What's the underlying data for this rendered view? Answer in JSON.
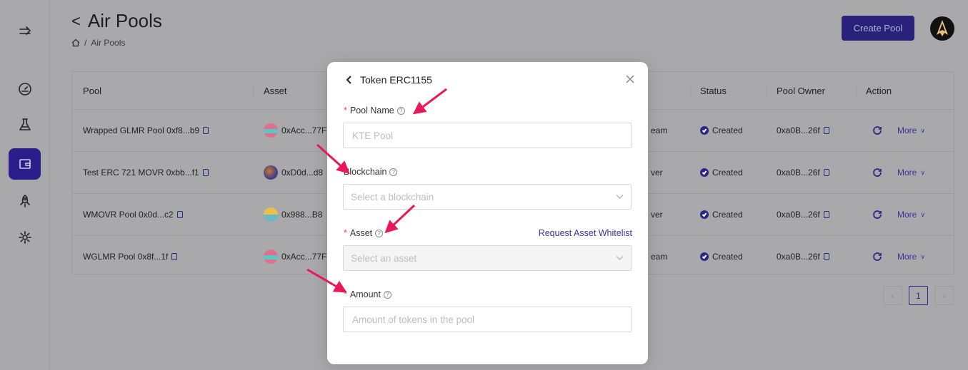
{
  "header": {
    "title": "Air Pools",
    "back_glyph": "<",
    "breadcrumb": [
      "Air Pools"
    ]
  },
  "actions": {
    "create_pool": "Create Pool"
  },
  "table": {
    "columns": [
      "Pool",
      "Asset",
      "Status",
      "Pool Owner",
      "Action"
    ],
    "rows": [
      {
        "pool": "Wrapped GLMR Pool 0xf8...b9",
        "asset": "0xAcc...77F",
        "network": "eam",
        "status": "Created",
        "owner": "0xa0B...26f",
        "more": "More"
      },
      {
        "pool": "Test ERC 721 MOVR 0xbb...f1",
        "asset": "0xD0d...d8",
        "network": "ver",
        "status": "Created",
        "owner": "0xa0B...26f",
        "more": "More"
      },
      {
        "pool": "WMOVR Pool 0x0d...c2",
        "asset": "0x988...B8",
        "network": "ver",
        "status": "Created",
        "owner": "0xa0B...26f",
        "more": "More"
      },
      {
        "pool": "WGLMR Pool 0x8f...1f",
        "asset": "0xAcc...77F",
        "network": "eam",
        "status": "Created",
        "owner": "0xa0B...26f",
        "more": "More"
      }
    ]
  },
  "pagination": {
    "current": "1"
  },
  "modal": {
    "title": "Token ERC1155",
    "pool_name": {
      "label": "Pool Name",
      "placeholder": "KTE Pool"
    },
    "blockchain": {
      "label": "Blockchain",
      "placeholder": "Select a blockchain"
    },
    "asset": {
      "label": "Asset",
      "placeholder": "Select an asset",
      "link": "Request Asset Whitelist"
    },
    "amount": {
      "label": "Amount",
      "placeholder": "Amount of tokens in the pool"
    },
    "required_mark": "*",
    "help_glyph": "?"
  },
  "colors": {
    "primary": "#2a2688",
    "annotation_arrow": "#e8185a",
    "required": "#e5484d"
  }
}
